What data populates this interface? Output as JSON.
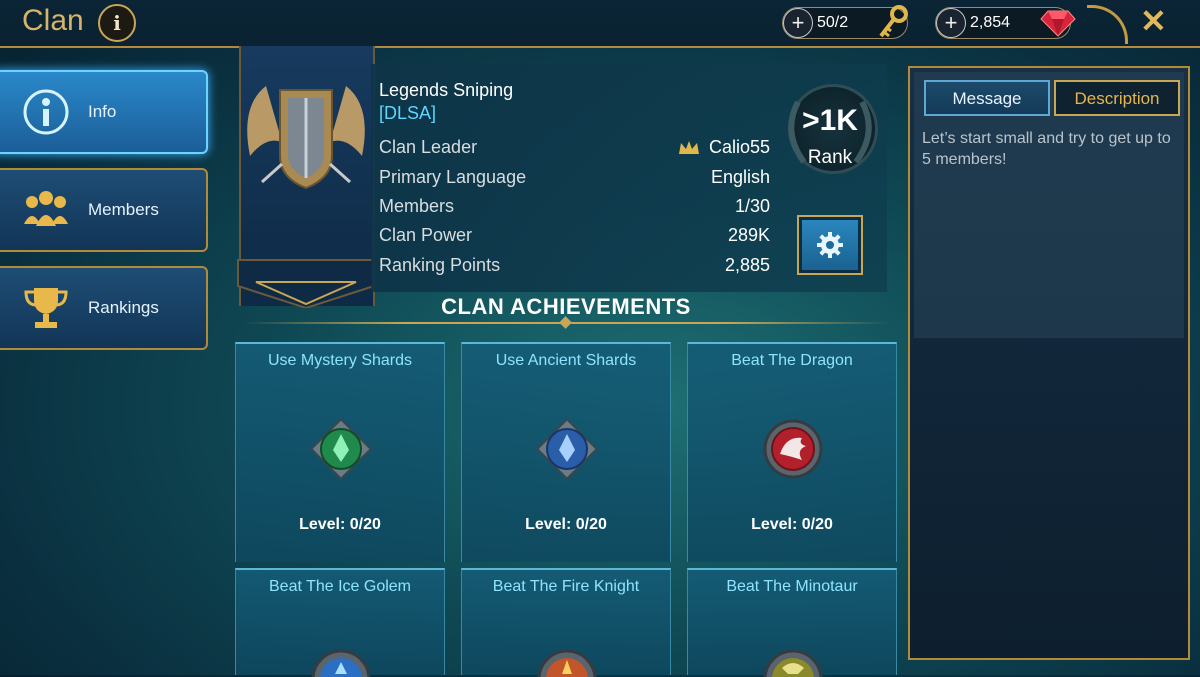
{
  "header": {
    "title": "Clan",
    "keys": "50/2",
    "gems": "2,854"
  },
  "sidebar": {
    "items": [
      {
        "label": "Info",
        "active": true
      },
      {
        "label": "Members",
        "active": false
      },
      {
        "label": "Rankings",
        "active": false
      }
    ]
  },
  "clan": {
    "name": "Legends Sniping",
    "tag": "[DLSA]",
    "rows": [
      {
        "label": "Clan Leader",
        "value": "Calio55"
      },
      {
        "label": "Primary Language",
        "value": "English"
      },
      {
        "label": "Members",
        "value": "1/30"
      },
      {
        "label": "Clan Power",
        "value": "289K"
      },
      {
        "label": "Ranking Points",
        "value": "2,885"
      }
    ],
    "rank_value": ">1K",
    "rank_label": "Rank"
  },
  "achievements": {
    "title": "CLAN ACHIEVEMENTS",
    "cards": [
      {
        "title": "Use Mystery Shards",
        "level": "Level: 0/20",
        "icon": "mystery-shard-icon"
      },
      {
        "title": "Use Ancient Shards",
        "level": "Level: 0/20",
        "icon": "ancient-shard-icon"
      },
      {
        "title": "Beat The Dragon",
        "level": "Level: 0/20",
        "icon": "dragon-icon"
      },
      {
        "title": "Beat The Ice Golem",
        "level": "",
        "icon": "ice-golem-icon"
      },
      {
        "title": "Beat The Fire Knight",
        "level": "",
        "icon": "fire-knight-icon"
      },
      {
        "title": "Beat The Minotaur",
        "level": "",
        "icon": "minotaur-icon"
      }
    ]
  },
  "right_panel": {
    "tabs": {
      "message": "Message",
      "description": "Description"
    },
    "text": "Let’s start small and try to get up to 5 members!"
  },
  "colors": {
    "gold": "#c9a556",
    "accent": "#5fd6ff"
  }
}
